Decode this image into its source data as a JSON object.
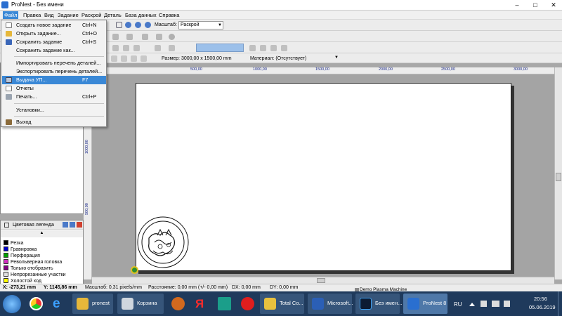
{
  "window": {
    "title": "ProNest - Без имени"
  },
  "menubar": [
    "Файл",
    "Правка",
    "Вид",
    "Задание",
    "Раскрой",
    "Деталь",
    "База данных",
    "Справка"
  ],
  "file_menu": [
    {
      "label": "Создать новое задание",
      "shortcut": "Ctrl+N"
    },
    {
      "label": "Открыть задание...",
      "shortcut": "Ctrl+O"
    },
    {
      "label": "Сохранить задание",
      "shortcut": "Ctrl+S"
    },
    {
      "label": "Сохранить задание как...",
      "shortcut": ""
    },
    {
      "label": "Импортировать перечень деталей...",
      "shortcut": ""
    },
    {
      "label": "Экспортировать перечень деталей...",
      "shortcut": ""
    },
    {
      "label": "Выдача УП...",
      "shortcut": "F7"
    },
    {
      "label": "Отчеты",
      "shortcut": ""
    },
    {
      "label": "Печать...",
      "shortcut": "Ctrl+P"
    },
    {
      "label": "Установки...",
      "shortcut": ""
    },
    {
      "label": "Выход",
      "shortcut": ""
    }
  ],
  "toolbar": {
    "scale_label": "Масштаб:",
    "scale_value": "Раскрой",
    "size_label": "Размер: 3000,00 x 1500,00 mm",
    "material_label": "Материал: (Отсутствует)"
  },
  "ruler": {
    "h": [
      "500,00",
      "1000,00",
      "1500,00",
      "2000,00",
      "2500,00",
      "3000,00"
    ],
    "v": [
      "1000,00",
      "500,00"
    ]
  },
  "legend": {
    "title": "Цветовая легенда",
    "items": [
      {
        "label": "Резка",
        "color": "#000000"
      },
      {
        "label": "Гравировка",
        "color": "#0000c8"
      },
      {
        "label": "Перфорация",
        "color": "#00a000"
      },
      {
        "label": "Револьверная головка",
        "color": "#d030c0"
      },
      {
        "label": "Только отобразить",
        "color": "#800080"
      },
      {
        "label": "Непрорезанные участки",
        "color": "#e0e0e0"
      },
      {
        "label": "Холостой ход",
        "color": "#ffff00"
      }
    ]
  },
  "status": {
    "x": "X: -273,21 mm",
    "y": "Y: 1145,86 mm",
    "scale": "Масштаб: 0,31 pixels/mm",
    "distance": "Расстояние: 0,00 mm (+/- 0,00 mm)",
    "dx": "DX: 0,00 mm",
    "dy": "DY: 0,00 mm",
    "machine": "Demo Plasma Machine"
  },
  "taskbar": {
    "items": [
      "pronest",
      "Корзина",
      "Total Co...",
      "Microsoft...",
      "Без имен...",
      "ProNest 8"
    ],
    "lang": "RU",
    "time": "20:56",
    "date": "05.06.2019"
  }
}
